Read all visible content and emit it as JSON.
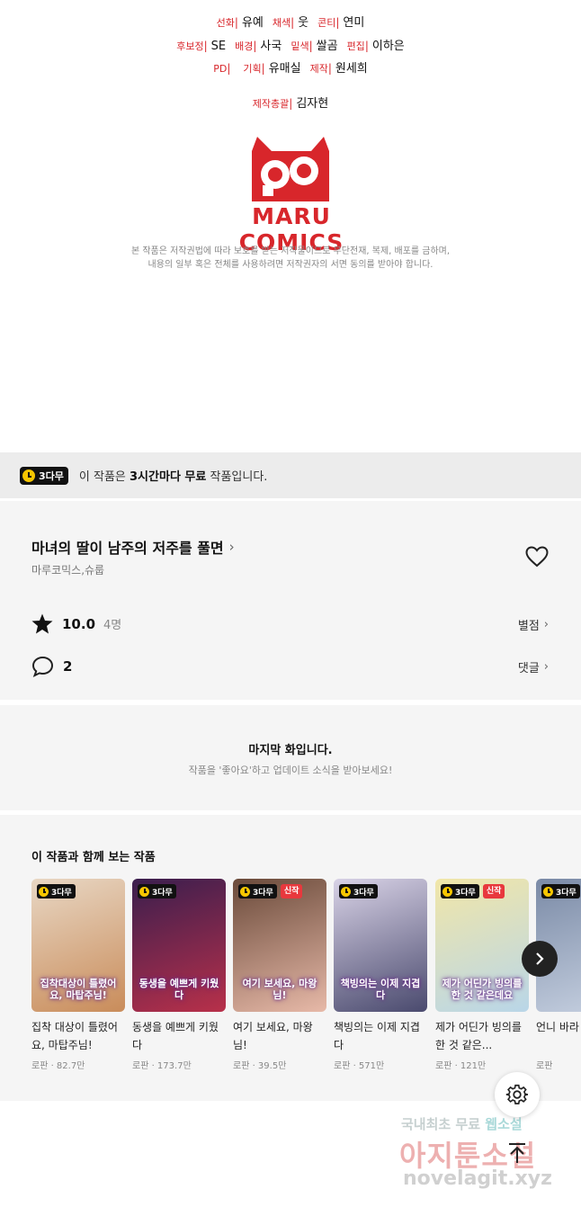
{
  "credits": {
    "lines": [
      [
        {
          "role": "선화",
          "name": "유예"
        },
        {
          "role": "채색",
          "name": "웃"
        },
        {
          "role": "콘티",
          "name": "연미"
        }
      ],
      [
        {
          "role": "후보정",
          "name": "SE"
        },
        {
          "role": "배경",
          "name": "사국"
        },
        {
          "role": "밑색",
          "name": "쌀곰"
        },
        {
          "role": "편집",
          "name": "이하은"
        }
      ],
      [
        {
          "role": "PD",
          "name": ""
        },
        {
          "role": "기획",
          "name": "유매실"
        },
        {
          "role": "제작",
          "name": "원세희"
        }
      ],
      [
        {
          "role": "제작총괄",
          "name": "김자현"
        }
      ]
    ],
    "logo_text": "MARU COMICS",
    "copyright_line1": "본 작품은 저작권법에 따라 보호를 받는 저작물이므로 무단전재, 복제, 배포를 금하며,",
    "copyright_line2": "내용의 일부 혹은 전체를 사용하려면 저작권자의 서면 동의를 받아야 합니다."
  },
  "free_banner": {
    "badge": "3다무",
    "text_prefix": "이 작품은 ",
    "text_bold": "3시간마다 무료",
    "text_suffix": " 작품입니다."
  },
  "info": {
    "title": "마녀의 딸이 남주의 저주를 풀면",
    "authors": "마루코믹스,슈룹",
    "rating": "10.0",
    "rating_count": "4명",
    "rating_link": "별점",
    "comments": "2",
    "comments_link": "댓글"
  },
  "last_episode": {
    "title": "마지막 화입니다.",
    "subtitle": "작품을 '좋아요'하고 업데이트 소식을 받아보세요!"
  },
  "recommendations": {
    "title": "이 작품과 함께 보는 작품",
    "items": [
      {
        "badge": "3다무",
        "new": "",
        "cover": "집착대상이 틀렸어요, 마탑주님!",
        "title": "집착 대상이 틀렸어요, 마탑주님!",
        "meta": "로판 · 82.7만",
        "c1": "#e8d7c4",
        "c2": "#c98c5a"
      },
      {
        "badge": "3다무",
        "new": "",
        "cover": "동생을 예쁘게 키웠다",
        "title": "동생을 예쁘게 키웠다",
        "meta": "로판 · 173.7만",
        "c1": "#3a1e4e",
        "c2": "#b8304a"
      },
      {
        "badge": "3다무",
        "new": "신작",
        "cover": "여기 보세요, 마왕님!",
        "title": "여기 보세요, 마왕님!",
        "meta": "로판 · 39.5만",
        "c1": "#6a4a3a",
        "c2": "#e7b9a8"
      },
      {
        "badge": "3다무",
        "new": "",
        "cover": "책빙의는 이제 지겹다",
        "title": "책빙의는 이제 지겹다",
        "meta": "로판 · 571만",
        "c1": "#d8d2e6",
        "c2": "#4a4a6e"
      },
      {
        "badge": "3다무",
        "new": "신작",
        "cover": "제가 어딘가 빙의를 한 것 같은데요",
        "title": "제가 어딘가 빙의를 한 것 같은...",
        "meta": "로판 · 121만",
        "c1": "#f1e6a8",
        "c2": "#b9d6e8"
      },
      {
        "badge": "3다무",
        "new": "",
        "cover": "",
        "title": "언니 바라",
        "meta": "로판",
        "c1": "#7a8aa6",
        "c2": "#c8d2e2"
      }
    ]
  },
  "watermark": {
    "line1a": "국내최초 무료",
    "line1b": "웹소설",
    "line2": "아지툰소설",
    "line3": "novelagit.xyz"
  },
  "colors": {
    "accent_red": "#d8262b",
    "badge_yellow": "#f7c600",
    "panel_bg": "#f5f5f5"
  },
  "icons": {
    "star": "star-icon",
    "comment": "comment-icon",
    "heart": "heart-icon",
    "settings": "gear-icon",
    "top": "arrow-up-icon",
    "next": "chevron-right-icon"
  }
}
